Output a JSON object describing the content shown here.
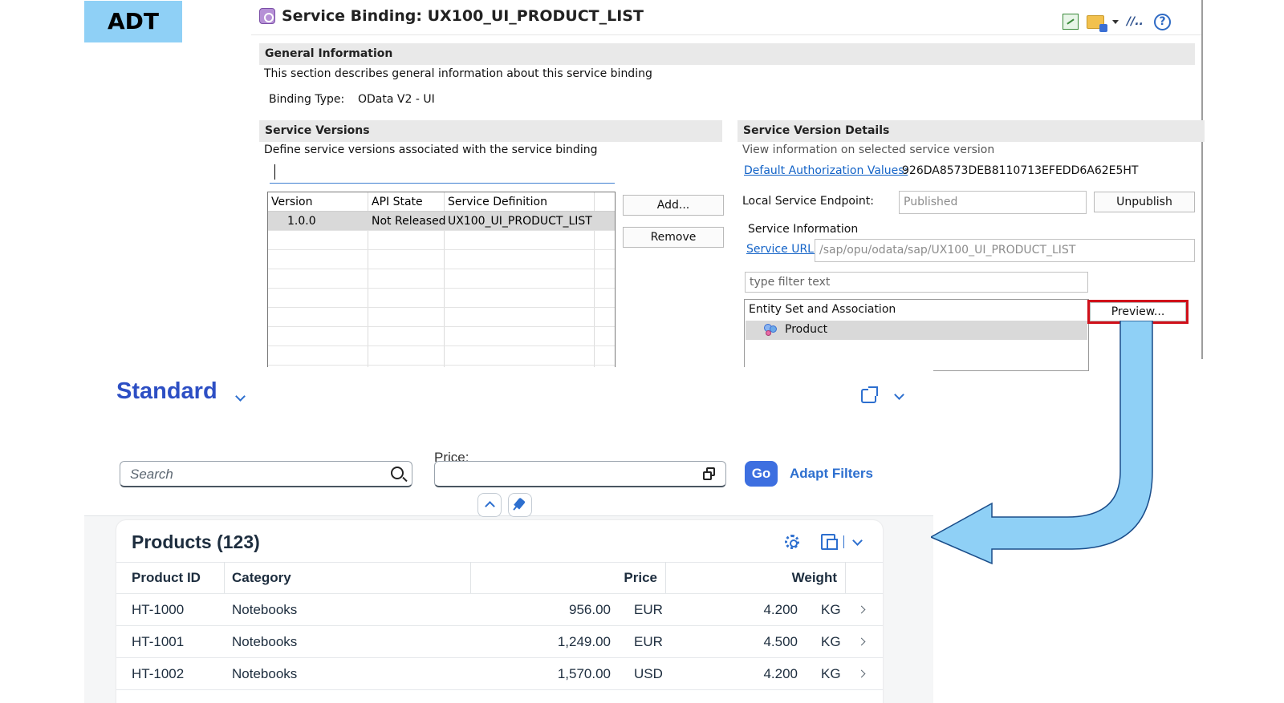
{
  "badge": {
    "label": "ADT"
  },
  "adt": {
    "title": "Service Binding: UX100_UI_PRODUCT_LIST",
    "toolbar_icons": [
      "export-excel-icon",
      "folder-icon",
      "dropdown-icon",
      "slash-icon",
      "help-icon"
    ],
    "help_glyph": "?",
    "slash_glyph": "//..",
    "general": {
      "heading": "General Information",
      "description": "This section describes general information about this service binding",
      "binding_type_label": "Binding Type:",
      "binding_type_value": "OData V2 - UI"
    },
    "versions": {
      "heading": "Service Versions",
      "description": "Define service versions associated with the service binding",
      "filter_value": "",
      "columns": [
        "Version",
        "API State",
        "Service Definition"
      ],
      "rows": [
        {
          "version": "1.0.0",
          "api_state": "Not Released",
          "service_definition": "UX100_UI_PRODUCT_LIST"
        }
      ],
      "add_label": "Add...",
      "remove_label": "Remove"
    },
    "details": {
      "heading": "Service Version Details",
      "description": "View information on selected service version",
      "auth_link": "Default Authorization Values:",
      "auth_value": "926DA8573DEB8110713EFEDD6A62E5HT",
      "endpoint_label": "Local Service Endpoint:",
      "endpoint_value": "Published",
      "unpublish_label": "Unpublish",
      "service_info_heading": "Service Information",
      "service_url_link": "Service URL:",
      "service_url_value": "/sap/opu/odata/sap/UX100_UI_PRODUCT_LIST",
      "filter_placeholder": "type filter text",
      "entity_heading": "Entity Set and Association",
      "entity_item": "Product",
      "preview_label": "Preview..."
    }
  },
  "fiori": {
    "variant_title": "Standard",
    "search_placeholder": "Search",
    "price_label": "Price:",
    "price_value": "",
    "go_label": "Go",
    "adapt_filters_label": "Adapt Filters",
    "table": {
      "title": "Products (123)",
      "columns": [
        "Product ID",
        "Category",
        "Price",
        "Weight"
      ],
      "rows": [
        {
          "product_id": "HT-1000",
          "category": "Notebooks",
          "price": "956.00",
          "currency": "EUR",
          "weight": "4.200",
          "unit": "KG"
        },
        {
          "product_id": "HT-1001",
          "category": "Notebooks",
          "price": "1,249.00",
          "currency": "EUR",
          "weight": "4.500",
          "unit": "KG"
        },
        {
          "product_id": "HT-1002",
          "category": "Notebooks",
          "price": "1,570.00",
          "currency": "USD",
          "weight": "4.200",
          "unit": "KG"
        }
      ]
    }
  },
  "colors": {
    "badge_bg": "#8fd0f6",
    "fiori_accent": "#2d6fcf",
    "variant_title": "#2d4fc4",
    "highlight_border": "#d0101a",
    "arrow_fill": "#8fd0f6"
  }
}
